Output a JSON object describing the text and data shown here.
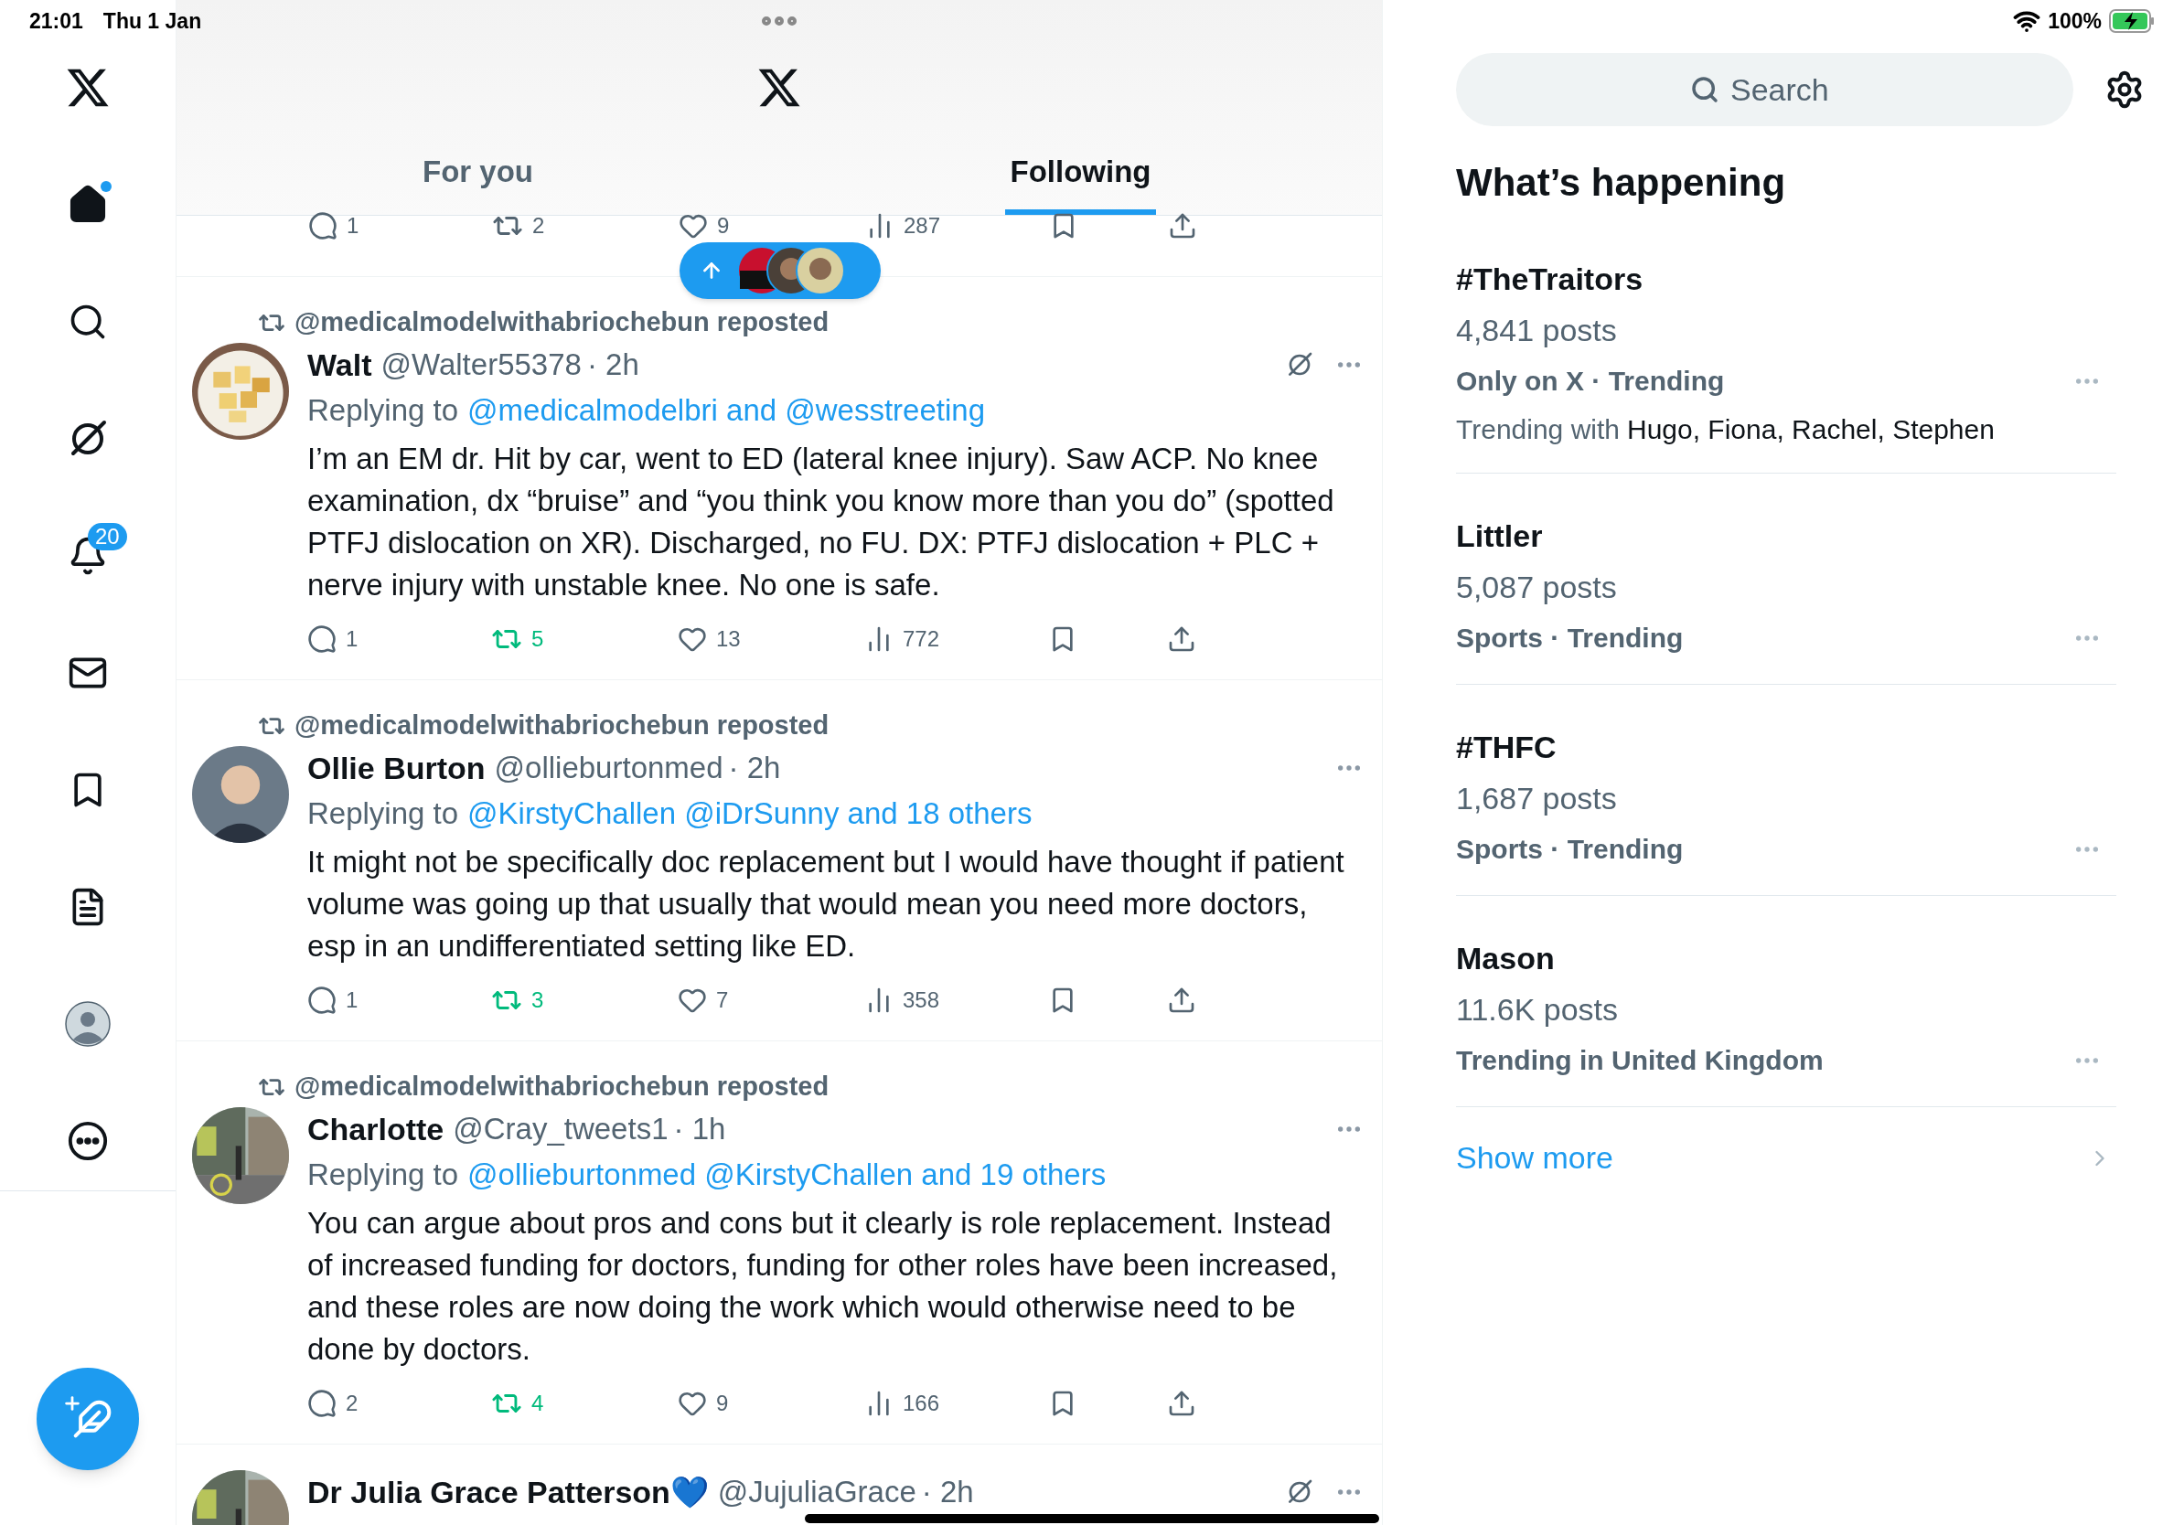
{
  "status_bar": {
    "time": "21:01",
    "date": "Thu 1 Jan",
    "battery": "100%"
  },
  "nav": [
    {
      "kind": "logo"
    },
    {
      "kind": "home",
      "selected": true
    },
    {
      "kind": "search",
      "selected": false
    },
    {
      "kind": "grok",
      "selected": false
    },
    {
      "kind": "notifications",
      "selected": false,
      "badge": "20"
    },
    {
      "kind": "messages",
      "selected": false
    },
    {
      "kind": "bookmarks",
      "selected": false
    },
    {
      "kind": "lists",
      "selected": false
    },
    {
      "kind": "profile",
      "selected": false
    },
    {
      "kind": "more",
      "selected": false
    }
  ],
  "tabs": [
    {
      "label": "For you",
      "selected": false
    },
    {
      "label": "Following",
      "selected": true
    }
  ],
  "partial_post": {
    "replies": "1",
    "reposts": "2",
    "likes": "9",
    "views": "287",
    "reposted": false
  },
  "posts": [
    {
      "reposted_by": "@medicalmodelwithabriochebun reposted",
      "avatar": {
        "kind": "food"
      },
      "name": "Walt",
      "handle": "@Walter55378",
      "time": "· 2h",
      "slash_icon": true,
      "replying_prefix": "Replying to",
      "replying_to": "@medicalmodelbri and @wesstreeting",
      "body": "I’m an EM dr. Hit by car, went to ED (lateral knee injury). Saw ACP. No knee examination, dx  “bruise” and “you think you know more than you do” (spotted PTFJ dislocation on XR). Discharged, no FU. DX: PTFJ dislocation + PLC + nerve injury with unstable knee. No one is safe.",
      "replies": "1",
      "reposts": "5",
      "likes": "13",
      "views": "772",
      "reposted": true
    },
    {
      "reposted_by": "@medicalmodelwithabriochebun reposted",
      "avatar": {
        "kind": "person"
      },
      "name": "Ollie Burton",
      "handle": "@ollieburtonmed",
      "time": "· 2h",
      "slash_icon": false,
      "replying_prefix": "Replying to",
      "replying_to": "@KirstyChallen @iDrSunny and 18 others",
      "body": "It might not be specifically doc replacement but I would have thought if patient volume was going up that usually that would mean you need more doctors, esp in an undifferentiated setting like ED.",
      "replies": "1",
      "reposts": "3",
      "likes": "7",
      "views": "358",
      "reposted": true
    },
    {
      "reposted_by": "@medicalmodelwithabriochebun reposted",
      "avatar": {
        "kind": "street"
      },
      "name": "Charlotte",
      "handle": "@Cray_tweets1",
      "time": "· 1h",
      "slash_icon": false,
      "replying_prefix": "Replying to",
      "replying_to": "@ollieburtonmed @KirstyChallen and 19 others",
      "body": "You can argue about pros and cons but it clearly is role replacement. Instead of increased funding for doctors, funding for other roles have been increased, and these roles are now doing the work which would otherwise need to be done by doctors.",
      "replies": "2",
      "reposts": "4",
      "likes": "9",
      "views": "166",
      "reposted": true
    },
    {
      "avatar": {
        "kind": "street"
      },
      "name": "Dr Julia Grace Patterson💙",
      "handle": "@JujuliaGrace",
      "time": "· 2h",
      "slash_icon": true
    }
  ],
  "sidebar": {
    "search_placeholder": "Search",
    "title": "What’s happening",
    "trends": [
      {
        "name": "#TheTraitors",
        "posts": "4,841 posts",
        "meta": "Only on X · Trending",
        "with_prefix": "Trending with",
        "with_names": "Hugo, Fiona, Rachel, Stephen"
      },
      {
        "name": "Littler",
        "posts": "5,087 posts",
        "meta": "Sports · Trending"
      },
      {
        "name": "#THFC",
        "posts": "1,687 posts",
        "meta": "Sports · Trending"
      },
      {
        "name": "Mason",
        "posts": "11.6K posts",
        "meta": "Trending in United Kingdom"
      }
    ],
    "show_more": "Show more"
  }
}
